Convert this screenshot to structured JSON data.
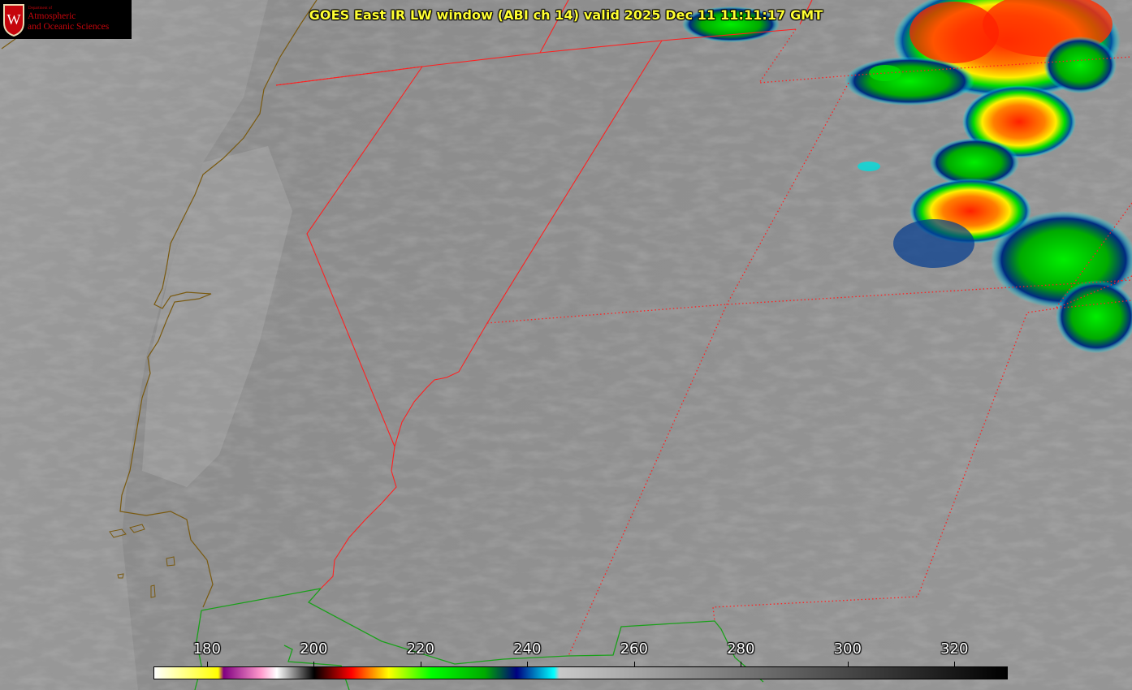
{
  "title": "GOES East IR LW window (ABI ch 14) valid 2025 Dec 11 11:11:17 GMT",
  "logo": {
    "department_line": "Department of",
    "line1": "Atmospheric",
    "line2": "and Oceanic Sciences",
    "crest_letter": "W"
  },
  "colorbar": {
    "min": 170,
    "max": 330,
    "ticks": [
      "180",
      "200",
      "220",
      "240",
      "260",
      "280",
      "300",
      "320"
    ],
    "tick_values": [
      180,
      200,
      220,
      240,
      260,
      280,
      300,
      320
    ],
    "stops": [
      {
        "v": 170,
        "c": "#ffffff"
      },
      {
        "v": 182,
        "c": "#ffff00"
      },
      {
        "v": 183,
        "c": "#800080"
      },
      {
        "v": 190,
        "c": "#ff99cc"
      },
      {
        "v": 193,
        "c": "#ffffff"
      },
      {
        "v": 200,
        "c": "#000000"
      },
      {
        "v": 207,
        "c": "#ff0000"
      },
      {
        "v": 214,
        "c": "#ffff00"
      },
      {
        "v": 222,
        "c": "#00ff00"
      },
      {
        "v": 232,
        "c": "#00aa00"
      },
      {
        "v": 238,
        "c": "#000080"
      },
      {
        "v": 245,
        "c": "#00ffff"
      },
      {
        "v": 246,
        "c": "#c8c8c8"
      },
      {
        "v": 330,
        "c": "#000000"
      }
    ]
  },
  "colors": {
    "state_border": "#ff2020",
    "coastline": "#7a5a10",
    "country_border": "#1aa01a",
    "title_text": "#ffff33",
    "cloud_cold": "#ff0000",
    "cloud_warm": "#00c000"
  }
}
